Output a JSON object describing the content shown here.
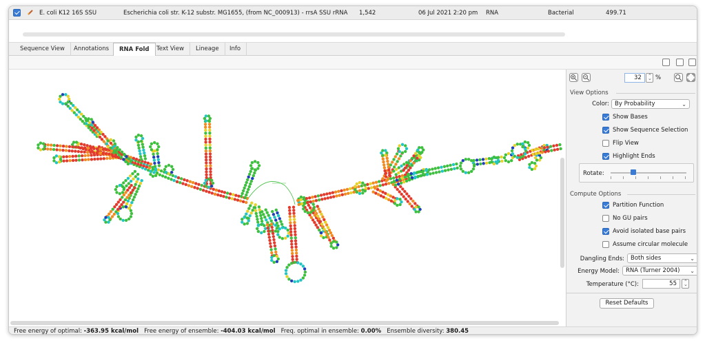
{
  "document_row": {
    "name": "E. coli K12 16S SSU",
    "description": "Escherichia coli str. K-12 substr. MG1655, (from NC_000913) - rrsA SSU rRNA",
    "length": "1,542",
    "modified": "06 Jul 2021 2:20 pm",
    "type": "RNA",
    "category": "Bacterial",
    "value": "499.71",
    "checked": true
  },
  "tabs": [
    {
      "label": "Sequence View"
    },
    {
      "label": "Annotations"
    },
    {
      "label": "RNA Fold"
    },
    {
      "label": "Text View"
    },
    {
      "label": "Lineage"
    },
    {
      "label": "Info"
    }
  ],
  "active_tab": "RNA Fold",
  "panel": {
    "zoom_value": "32",
    "zoom_unit": "%",
    "view_options_title": "View Options",
    "color_label": "Color:",
    "color_value": "By Probability",
    "view_checks": [
      {
        "label": "Show Bases",
        "checked": true
      },
      {
        "label": "Show Sequence Selection",
        "checked": true
      },
      {
        "label": "Flip View",
        "checked": false
      },
      {
        "label": "Highlight Ends",
        "checked": true
      }
    ],
    "rotate_label": "Rotate:",
    "rotate_fraction": 0.3,
    "compute_options_title": "Compute Options",
    "compute_checks": [
      {
        "label": "Partition Function",
        "checked": true
      },
      {
        "label": "No GU pairs",
        "checked": false
      },
      {
        "label": "Avoid isolated base pairs",
        "checked": true
      },
      {
        "label": "Assume circular molecule",
        "checked": false
      }
    ],
    "dangling_label": "Dangling Ends:",
    "dangling_value": "Both sides",
    "energy_label": "Energy Model:",
    "energy_value": "RNA (Turner 2004)",
    "temp_label": "Temperature (°C):",
    "temp_value": "55",
    "reset_label": "Reset Defaults"
  },
  "status": {
    "free_energy_optimal_label": "Free energy of optimal: ",
    "free_energy_optimal": "-363.95 kcal/mol",
    "free_energy_ensemble_label": "Free energy of ensemble: ",
    "free_energy_ensemble": "-404.03 kcal/mol",
    "freq_label": "Freq. optimal in ensemble: ",
    "freq_value": "0.00%",
    "diversity_label": "Ensemble diversity: ",
    "diversity_value": "380.45"
  },
  "colors": {
    "accent": "#3a7bd5",
    "base_red": "#e23b2e",
    "base_orange": "#f08c22",
    "base_yellow": "#e6d22a",
    "base_green": "#3fbf3f",
    "base_cyan": "#22c4c4",
    "base_blue": "#1f3fb8"
  },
  "icons": {
    "document": "sequence-doc-icon",
    "zoom_in": "zoom-in-icon",
    "zoom_out": "zoom-out-icon",
    "zoom_fit": "zoom-fit-icon",
    "fullscreen": "fullscreen-icon"
  }
}
